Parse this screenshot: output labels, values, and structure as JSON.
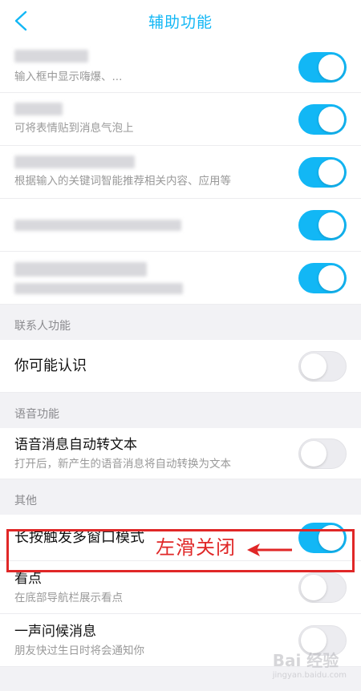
{
  "nav": {
    "title": "辅助功能"
  },
  "top_rows": [
    {
      "desc": "输入框中显示嗨爆、...",
      "enabled": true
    },
    {
      "desc": "可将表情贴到消息气泡上",
      "enabled": true
    },
    {
      "desc": "根据输入的关键词智能推荐相关内容、应用等",
      "enabled": true
    },
    {
      "enabled": true
    },
    {
      "enabled": true
    }
  ],
  "sections": {
    "contacts": {
      "header": "联系人功能",
      "item_title": "你可能认识",
      "enabled": false
    },
    "voice": {
      "header": "语音功能",
      "item_title": "语音消息自动转文本",
      "item_desc": "打开后，新产生的语音消息将自动转换为文本",
      "enabled": false
    },
    "other": {
      "header": "其他",
      "items": [
        {
          "title": "长按触发多窗口模式",
          "enabled": true
        },
        {
          "title": "看点",
          "desc": "在底部导航栏展示看点",
          "enabled": false
        },
        {
          "title": "一声问候消息",
          "desc": "朋友快过生日时将会通知你",
          "enabled": false
        }
      ]
    }
  },
  "annotation": {
    "text": "左滑关闭",
    "color": "#e02727"
  },
  "watermark": {
    "text": "Bai 经验",
    "sub": "jingyan.baidu.com"
  },
  "colors": {
    "accent": "#12b7f5",
    "toggle_off": "#ececf0"
  }
}
